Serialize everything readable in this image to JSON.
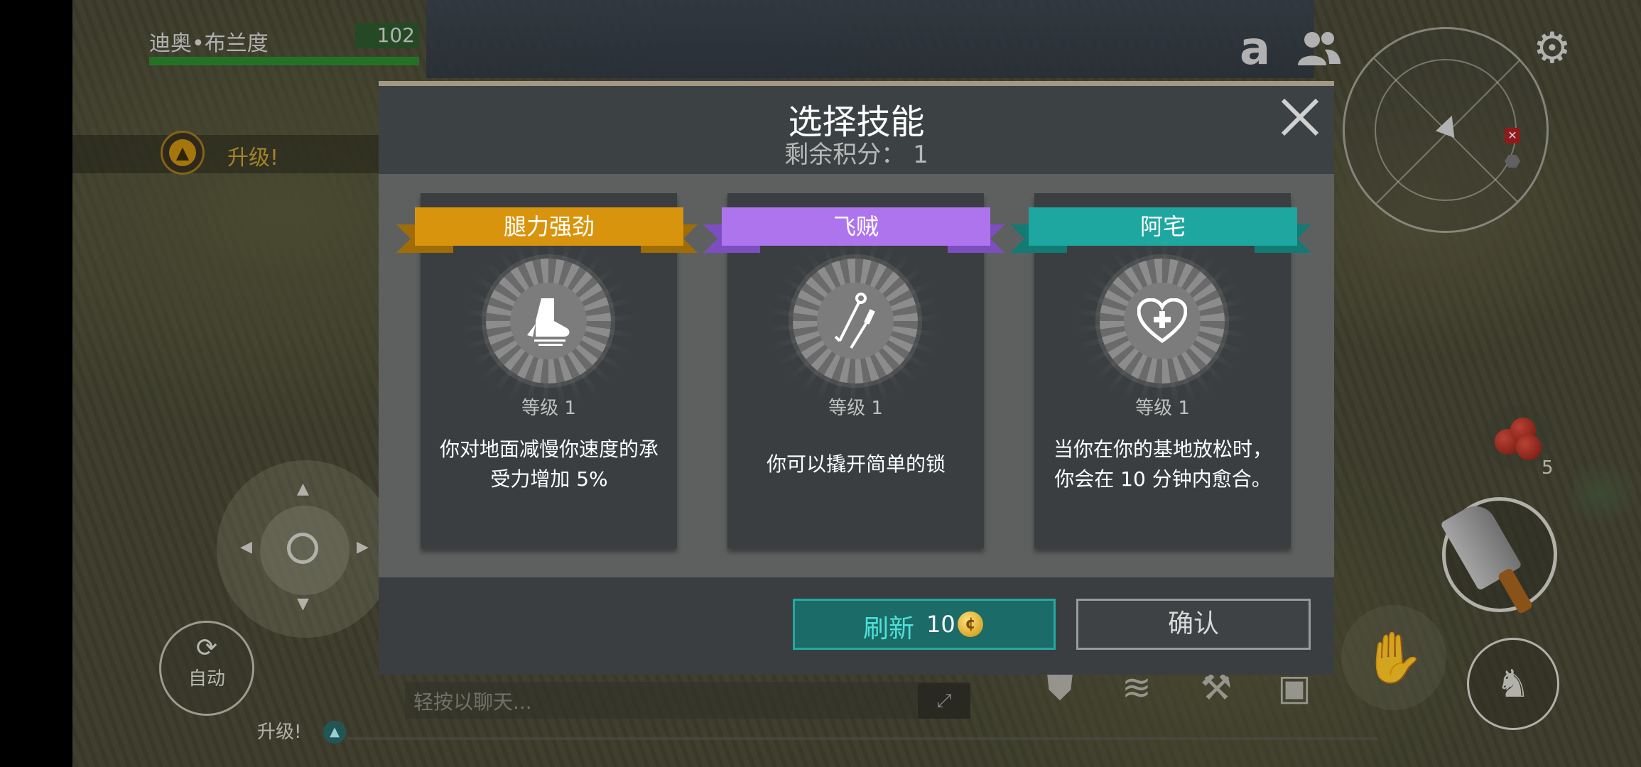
{
  "hud": {
    "player_name": "迪奥•布兰度",
    "player_level": "102",
    "health_fraction": 1.0,
    "levelup_label": "升级!",
    "auto_label": "自动",
    "bottom_levelup_label": "升级!",
    "chat_placeholder": "轻按以聊天...",
    "berries_count": "5"
  },
  "icons": {
    "amazon": "amazon-icon",
    "friends": "friends-icon",
    "settings": "gear-icon",
    "minimap": "minimap",
    "expand": "expand-icon",
    "clan": "clan-shield-icon",
    "coins": "coin-stack-icon",
    "map": "map-icon",
    "backpack": "backpack-icon",
    "grab": "hand-icon",
    "crouch": "crouch-icon",
    "weapon": "cleaver-icon"
  },
  "dialog": {
    "title": "选择技能",
    "points_label": "剩余积分：",
    "points_value": "1",
    "cards": [
      {
        "name": "腿力强劲",
        "color": "#d9940d",
        "icon": "boot-icon",
        "level": "等级 1",
        "desc_line1": "你对地面减慢你速度的承",
        "desc_line2": "受力增加 5%"
      },
      {
        "name": "飞贼",
        "color": "#ae74ee",
        "icon": "lockpick-icon",
        "level": "等级 1",
        "desc_line1": "你可以撬开简单的锁",
        "desc_line2": ""
      },
      {
        "name": "阿宅",
        "color": "#1ea7a0",
        "icon": "heart-plus-icon",
        "level": "等级 1",
        "desc_line1": "当你在你的基地放松时，",
        "desc_line2": "你会在 10 分钟内愈合。"
      }
    ],
    "refresh_label": "刷新",
    "refresh_cost": "10",
    "confirm_label": "确认"
  }
}
